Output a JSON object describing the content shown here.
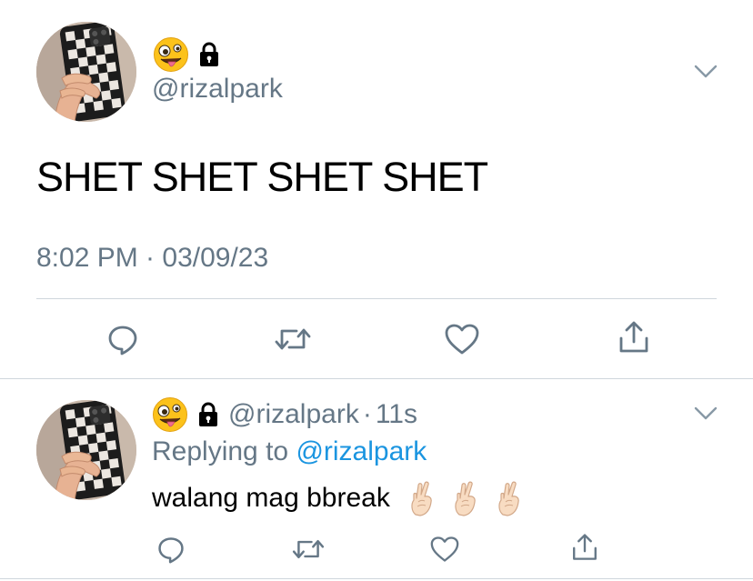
{
  "tweet": {
    "author_handle": "@rizalpark",
    "text": "SHET SHET SHET SHET",
    "timestamp": "8:02 PM · 03/09/23",
    "emoji_name": "zany-face",
    "locked": true,
    "icons": {
      "reply": "reply-icon",
      "retweet": "retweet-icon",
      "like": "heart-icon",
      "share": "share-icon",
      "more": "chevron-down-icon"
    }
  },
  "reply": {
    "author_handle": "@rizalpark",
    "separator": "·",
    "age": "11s",
    "replying_prefix": "Replying to",
    "replying_to": "@rizalpark",
    "text": "walang mag bbreak",
    "trailing_emoji": [
      "crossed-fingers",
      "crossed-fingers",
      "crossed-fingers"
    ]
  },
  "colors": {
    "secondary_text": "#657786",
    "link": "#1b95e0",
    "divider": "#cfd6dc",
    "icon": "#657786"
  }
}
